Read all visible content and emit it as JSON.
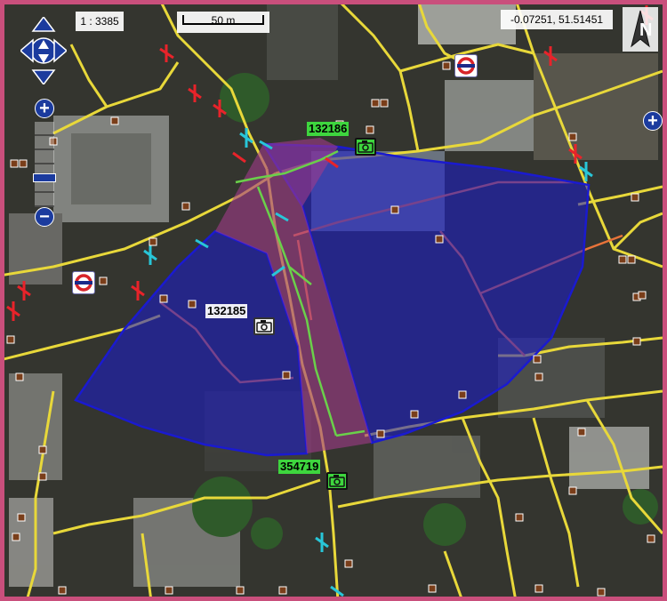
{
  "map": {
    "scale_label": "1 : 3385",
    "scalebar_label": "50 m",
    "coordinates": "-0.07251, 51.51451",
    "north_label": "N"
  },
  "controls": {
    "pan_up": "up-arrow",
    "pan_down": "down-arrow",
    "pan_left": "left-arrow",
    "pan_right": "right-arrow",
    "zoom_in": "+",
    "zoom_out": "−",
    "zoom_in_right": "+"
  },
  "photos": [
    {
      "id": "132186",
      "style": "green"
    },
    {
      "id": "132185",
      "style": "white"
    },
    {
      "id": "354719",
      "style": "green"
    }
  ],
  "colors": {
    "road": "#e8d83a",
    "footpath": "#6ad04a",
    "boundary": "#e8733a",
    "view_cone": "#1a1ad0",
    "camera_green": "#3ed63e",
    "frame": "#c94f7c"
  }
}
